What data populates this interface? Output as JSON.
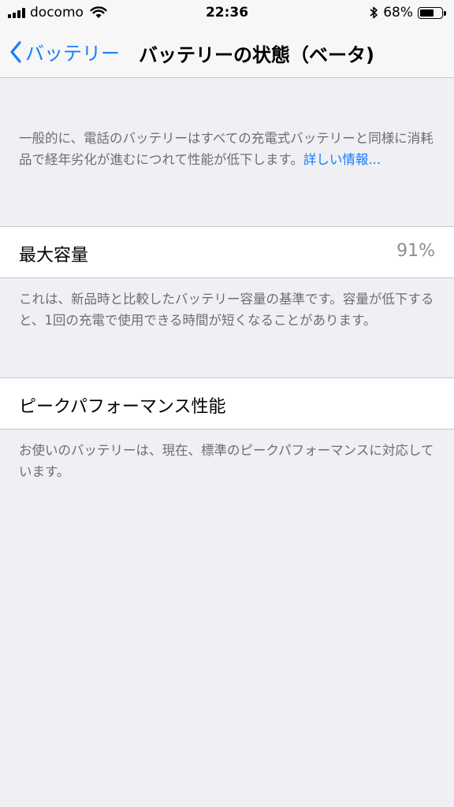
{
  "status_bar": {
    "carrier": "docomo",
    "time": "22:36",
    "battery_percent": "68%",
    "battery_level": 0.68,
    "icons": [
      "signal-icon",
      "wifi-icon",
      "bluetooth-icon",
      "battery-icon"
    ]
  },
  "nav": {
    "back_label": "バッテリー",
    "title": "バッテリーの状態（ベータ)"
  },
  "intro": {
    "text": "一般的に、電話のバッテリーはすべての充電式バッテリーと同様に消耗品で経年劣化が進むにつれて性能が低下します。",
    "link": "詳しい情報..."
  },
  "max_capacity": {
    "label": "最大容量",
    "value": "91%",
    "footer": "これは、新品時と比較したバッテリー容量の基準です。容量が低下すると、1回の充電で使用できる時間が短くなることがあります。"
  },
  "peak_performance": {
    "label": "ピークパフォーマンス性能",
    "footer": "お使いのバッテリーは、現在、標準のピークパフォーマンスに対応しています。"
  },
  "colors": {
    "accent": "#157efb",
    "background": "#efeff4",
    "secondary_text": "#6d6d72"
  }
}
